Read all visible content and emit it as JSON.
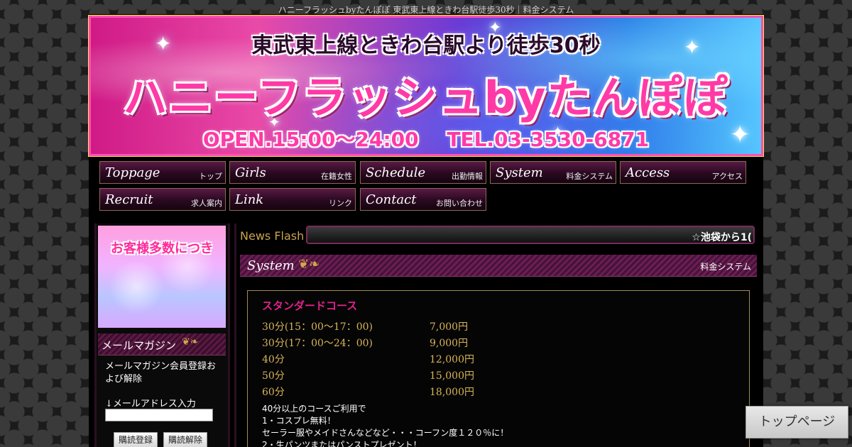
{
  "page_title": "ハニーフラッシュbyたんぽぽ 東武東上線ときわ台駅徒歩30秒｜料金システム",
  "banner": {
    "top_text": "東武東上線ときわ台駅より徒歩30秒",
    "main_text": "ハニーフラッシュbyたんぽぽ",
    "bottom_text": "OPEN.15:00～24:00 TEL.03-3530-6871"
  },
  "nav": [
    {
      "en": "Toppage",
      "ja": "トップ"
    },
    {
      "en": "Girls",
      "ja": "在籍女性"
    },
    {
      "en": "Schedule",
      "ja": "出勤情報"
    },
    {
      "en": "System",
      "ja": "料金システム"
    },
    {
      "en": "Access",
      "ja": "アクセス"
    },
    {
      "en": "Recruit",
      "ja": "求人案内"
    },
    {
      "en": "Link",
      "ja": "リンク"
    },
    {
      "en": "Contact",
      "ja": "お問い合わせ"
    }
  ],
  "sidebar": {
    "ad_text": "お客様多数につき",
    "mailmag_title": "メールマガジン",
    "mailmag_desc": "メールマガジン会員登録および解除",
    "email_label": "↓メールアドレス入力",
    "email_value": "",
    "subscribe_label": "購読登録",
    "unsubscribe_label": "購読解除"
  },
  "news": {
    "label": "News Flash",
    "ticker": "☆池袋から1("
  },
  "section": {
    "en": "System",
    "ja": "料金システム"
  },
  "course": {
    "title": "スタンダードコース",
    "rows": [
      {
        "time": "30分(15：00～17：00)",
        "price": "7,000円"
      },
      {
        "time": "30分(17：00～24：00)",
        "price": "9,000円"
      },
      {
        "time": "40分",
        "price": "12,000円"
      },
      {
        "time": "50分",
        "price": "15,000円"
      },
      {
        "time": "60分",
        "price": "18,000円"
      }
    ],
    "note_lines": [
      "40分以上のコースご利用で",
      "1・コスプレ無料！",
      "セーラー服やメイドさんなどなど・・・コーフン度１２０％に！",
      "2・生パンツまたはパンストプレゼント！"
    ]
  },
  "top_button": "トップページ"
}
